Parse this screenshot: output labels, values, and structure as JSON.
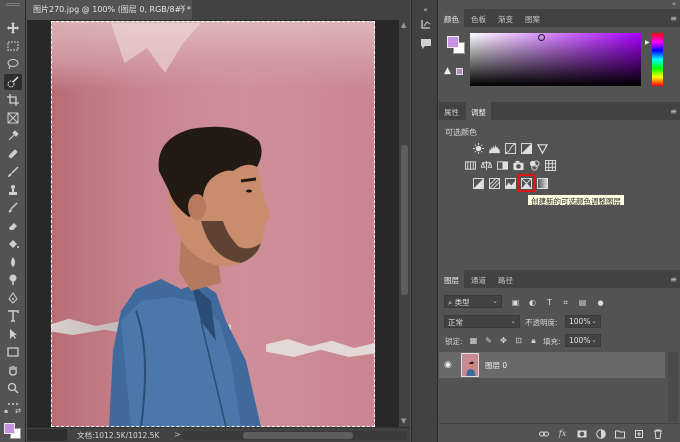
{
  "document": {
    "tab_title": "图片270.jpg @ 100% (图层 0, RGB/8#) *",
    "close_glyph": "×"
  },
  "status": {
    "doc_size": "文档:1012.5K/1012.5K",
    "arrow_glyph": ">"
  },
  "color_panel": {
    "tabs": [
      "颜色",
      "色板",
      "渐变",
      "图案"
    ],
    "active_tab": 0,
    "foreground_color": "#c792de",
    "background_color": "#ffffff"
  },
  "adjustments_panel": {
    "tabs": [
      "属性",
      "调整"
    ],
    "active_tab": 1,
    "title": "可选颜色",
    "tooltip": "创建新的可选颜色调整图层",
    "highlight_color": "#e01515"
  },
  "layers_panel": {
    "tabs": [
      "图层",
      "通道",
      "路径"
    ],
    "active_tab": 0,
    "filter_kind": "类型",
    "blend_mode": "正常",
    "opacity_label": "不透明度:",
    "opacity_value": "100%",
    "lock_label": "锁定:",
    "fill_label": "填充:",
    "fill_value": "100%",
    "layers": [
      {
        "name": "图层 0",
        "visible": true,
        "selected": true
      }
    ]
  },
  "menu_glyph": "≡",
  "collapse_glyph": "«"
}
